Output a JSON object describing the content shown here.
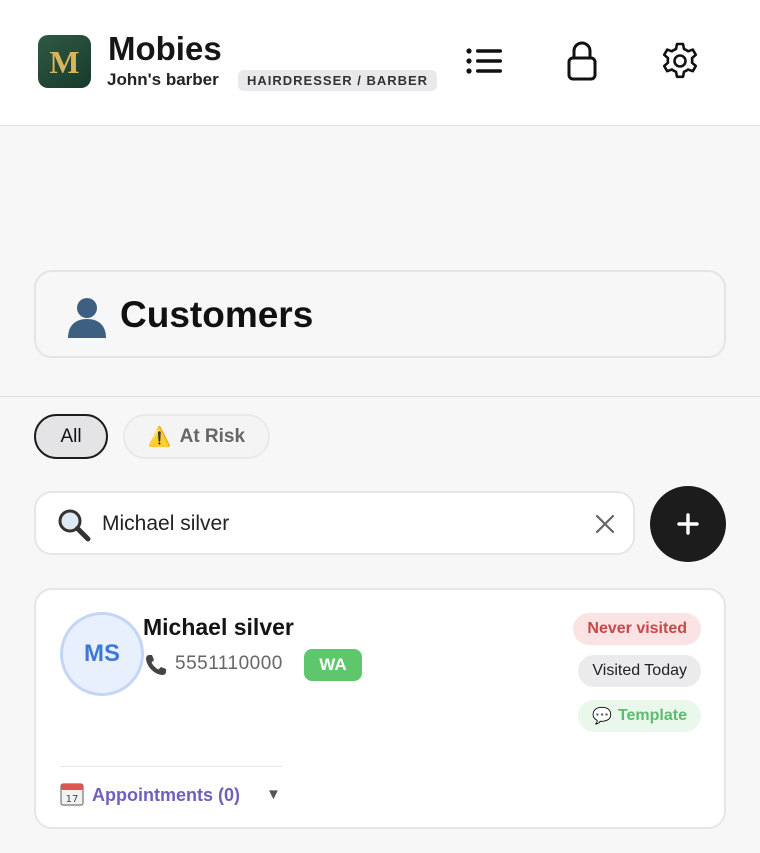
{
  "header": {
    "logo_letter": "M",
    "app_title": "Mobies",
    "business_name": "John's barber",
    "business_category": "HAIRDRESSER / BARBER",
    "icons": {
      "menu": "list-icon",
      "lock": "lock-icon",
      "settings": "gear-icon"
    }
  },
  "page": {
    "title_icon": "person-silhouette-icon",
    "title": "Customers"
  },
  "filters": {
    "all_label": "All",
    "at_risk_icon": "⚠️",
    "at_risk_label": "At Risk",
    "selected": "All"
  },
  "search": {
    "value": "Michael silver",
    "placeholder": ""
  },
  "add_button_icon": "plus-icon",
  "customers": [
    {
      "initials": "MS",
      "name": "Michael silver",
      "phone": "5551110000",
      "wa_label": "WA",
      "status_never": "Never visited",
      "status_visited": "Visited Today",
      "template_icon": "💬",
      "template_label": "Template",
      "appointments_label": "Appointments (0)",
      "appointments_caret": "▼"
    }
  ],
  "colors": {
    "accent_dark": "#1c1c1d",
    "wa_green": "#5fc76b",
    "never_red": "#c74848",
    "appointments_purple": "#6f5fbf",
    "avatar_blue": "#3d78d8"
  }
}
